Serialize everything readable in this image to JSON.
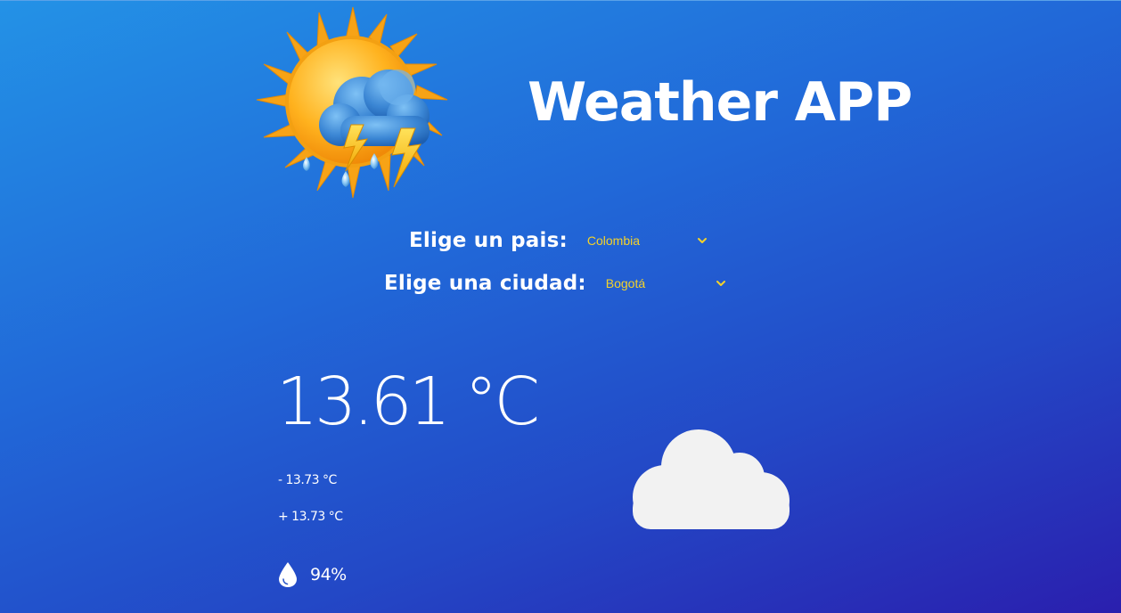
{
  "header": {
    "title": "Weather APP",
    "logo_icon": "sun-cloud-storm-icon"
  },
  "selectors": {
    "country": {
      "label": "Elige un pais:",
      "value": "Colombia"
    },
    "city": {
      "label": "Elige una ciudad:",
      "value": "Bogotá"
    }
  },
  "weather": {
    "temperature": "13.61 °C",
    "min_temp": "- 13.73 °C",
    "max_temp": "+ 13.73 °C",
    "humidity": "94%",
    "condition_icon": "cloud-icon"
  },
  "colors": {
    "background_start": "#2392e6",
    "background_end": "#2a1fae",
    "select_text": "#f4d22a",
    "text": "#ffffff"
  }
}
